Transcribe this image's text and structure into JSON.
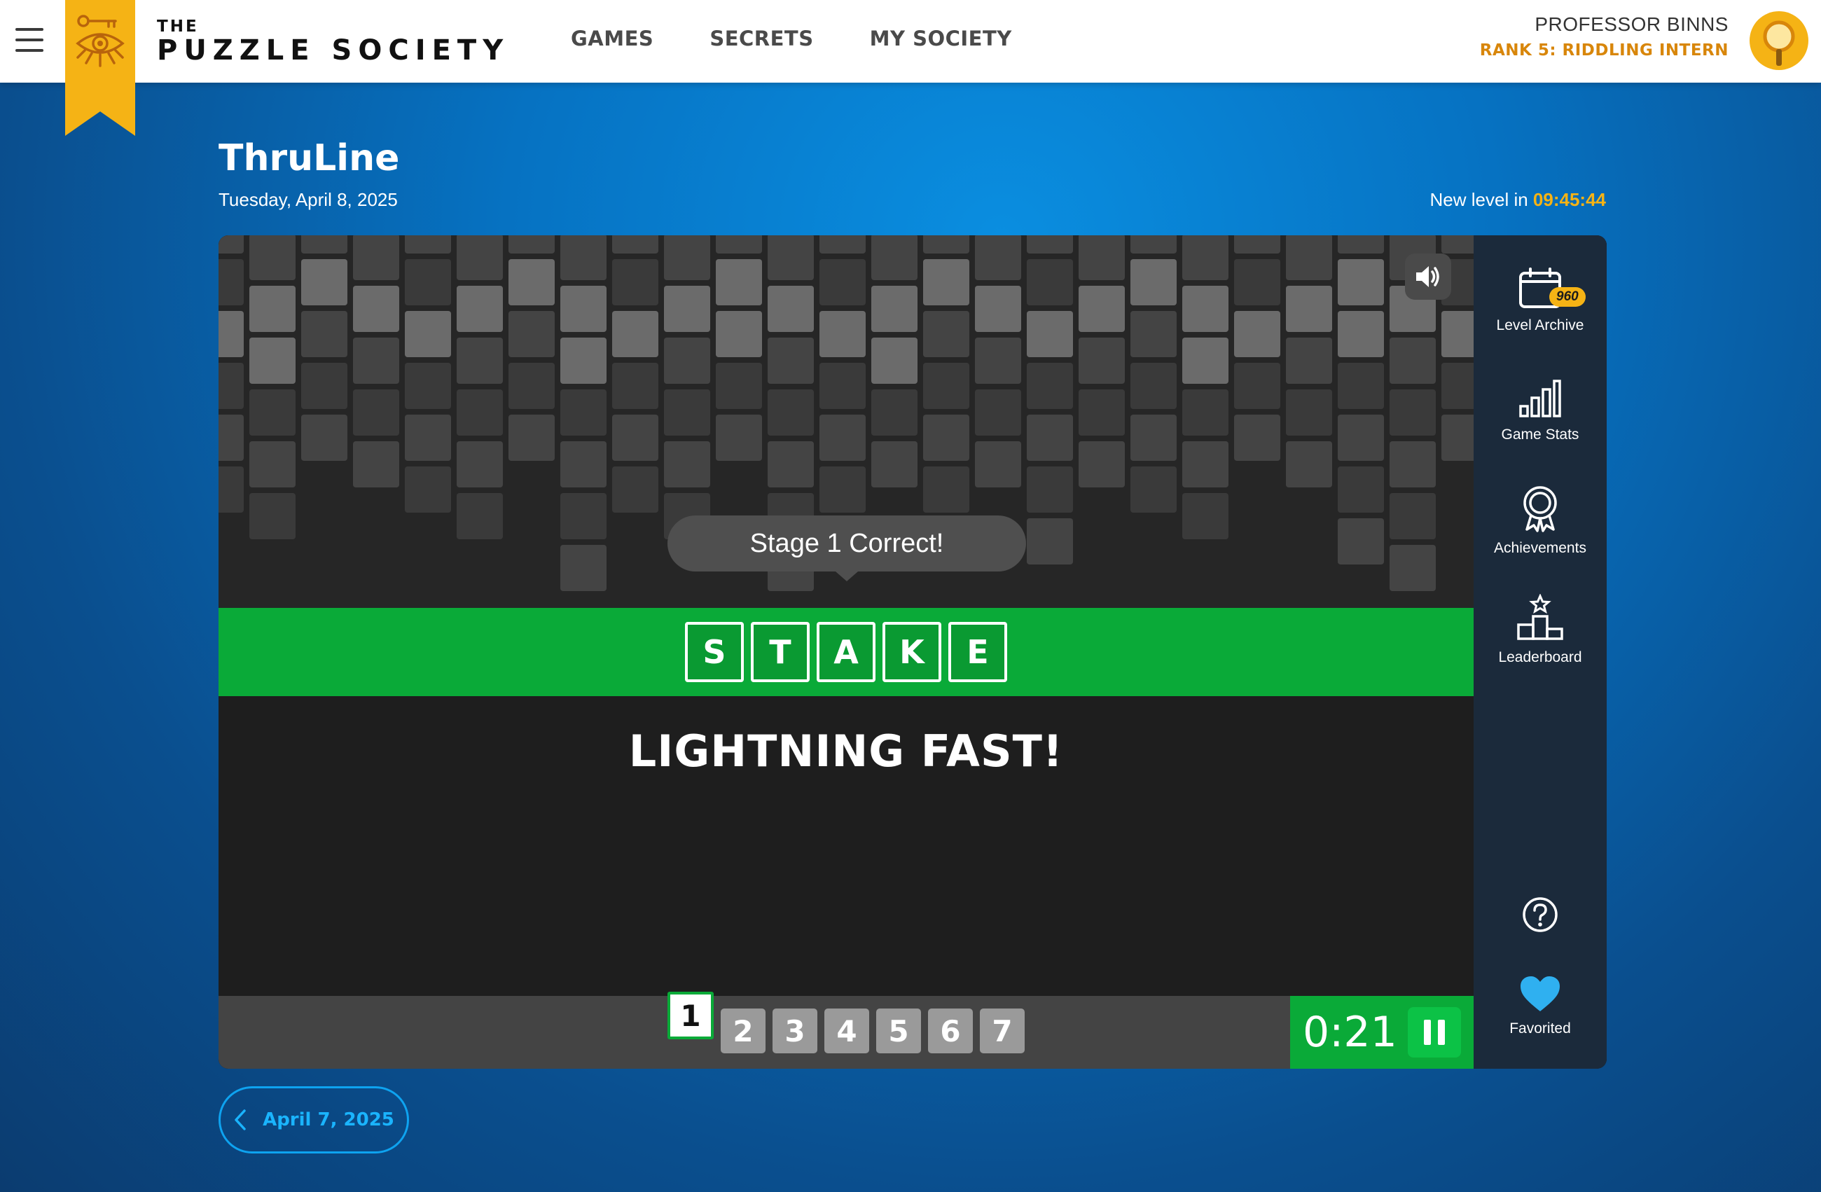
{
  "brand": {
    "the": "THE",
    "name": "PUZZLE SOCIETY"
  },
  "nav": {
    "games": "GAMES",
    "secrets": "SECRETS",
    "my_society": "MY SOCIETY"
  },
  "user": {
    "name": "PROFESSOR BINNS",
    "rank": "RANK 5: RIDDLING INTERN"
  },
  "game": {
    "title": "ThruLine",
    "date": "Tuesday, April 8, 2025",
    "new_level_prefix": "New level in",
    "new_level_timer": "09:45:44"
  },
  "toast": "Stage 1 Correct!",
  "answer_letters": [
    "S",
    "T",
    "A",
    "K",
    "E"
  ],
  "praise": "LIGHTNING FAST!",
  "stages": [
    "1",
    "2",
    "3",
    "4",
    "5",
    "6",
    "7"
  ],
  "current_stage": "1",
  "timer": "0:21",
  "rail": {
    "level_archive": "Level Archive",
    "level_archive_badge": "960",
    "game_stats": "Game Stats",
    "achievements": "Achievements",
    "leaderboard": "Leaderboard",
    "favorited": "Favorited"
  },
  "prev_date": "April 7, 2025",
  "colors": {
    "accent_gold": "#f5b315",
    "success_green": "#0aaa38",
    "favorite_blue": "#2fb0f0",
    "link_blue": "#1ab4ff"
  }
}
